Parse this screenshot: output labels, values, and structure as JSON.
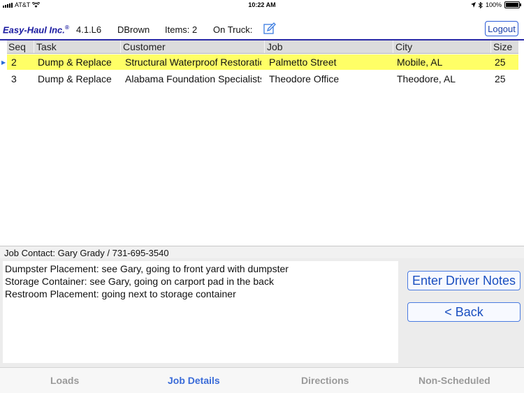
{
  "status_bar": {
    "carrier": "AT&T",
    "time": "10:22 AM",
    "battery": "100%"
  },
  "header": {
    "brand": "Easy-Haul Inc.",
    "brand_mark": "®",
    "version": "4.1.L6",
    "user": "DBrown",
    "items": "Items: 2",
    "on_truck": "On Truck:",
    "logout": "Logout"
  },
  "table": {
    "columns": [
      "Seq",
      "Task",
      "Customer",
      "Job",
      "City",
      "Size"
    ],
    "rows": [
      [
        "2",
        "Dump & Replace",
        "Structural Waterproof Restoration",
        "Palmetto Street",
        "Mobile, AL",
        "25"
      ],
      [
        "3",
        "Dump & Replace",
        "Alabama Foundation Specialists",
        "Theodore Office",
        "Theodore, AL",
        "25"
      ]
    ],
    "selected_index": 0,
    "highlight_color": "#ffff66"
  },
  "job_contact": "Job Contact: Gary Grady / 731-695-3540",
  "notes": [
    "Dumpster Placement: see Gary, going to front yard with dumpster",
    "Storage Container: see Gary, going on carport pad in the back",
    "Restroom Placement: going next to storage container"
  ],
  "buttons": {
    "enter_driver_notes": "Enter Driver Notes",
    "back": "< Back"
  },
  "tabs": [
    {
      "label": "Loads",
      "active": false
    },
    {
      "label": "Job Details",
      "active": true
    },
    {
      "label": "Directions",
      "active": false
    },
    {
      "label": "Non-Scheduled",
      "active": false
    }
  ],
  "colors": {
    "accent": "#3a6bd8",
    "brand": "#1a1aa0"
  }
}
